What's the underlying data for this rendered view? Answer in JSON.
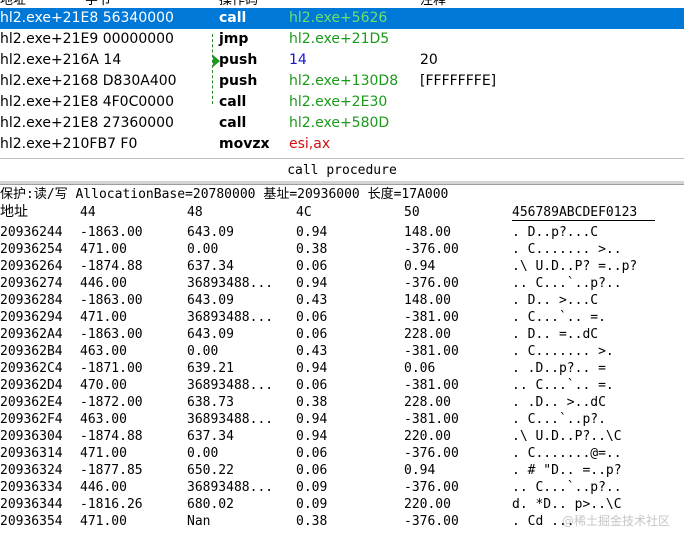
{
  "disasm": {
    "headers": {
      "address": "地址",
      "bytes": "字节",
      "mnemonic": "操作码",
      "comment": "注释"
    },
    "rows": [
      {
        "address": "hl2.exe+21E8 56340000",
        "mnemonic": "call",
        "operand": "hl2.exe+5626",
        "operand_color": "green",
        "comment": "",
        "selected": true
      },
      {
        "address": "hl2.exe+21E9 00000000",
        "mnemonic": "jmp",
        "operand": "hl2.exe+21D5",
        "operand_color": "green",
        "comment": "",
        "selected": false
      },
      {
        "address": "hl2.exe+216A 14",
        "mnemonic": "push",
        "operand": "14",
        "operand_color": "blue",
        "comment": "20",
        "selected": false
      },
      {
        "address": "hl2.exe+2168 D830A400",
        "mnemonic": "push",
        "operand": "hl2.exe+130D8",
        "operand_color": "green",
        "comment": "[FFFFFFFE]",
        "selected": false
      },
      {
        "address": "hl2.exe+21E8 4F0C0000",
        "mnemonic": "call",
        "operand": "hl2.exe+2E30",
        "operand_color": "green",
        "comment": "",
        "selected": false
      },
      {
        "address": "hl2.exe+21E8 27360000",
        "mnemonic": "call",
        "operand": "hl2.exe+580D",
        "operand_color": "green",
        "comment": "",
        "selected": false
      },
      {
        "address": "hl2.exe+210FB7 F0",
        "mnemonic": "movzx",
        "operand": "esi,ax",
        "operand_color": "red",
        "comment": "",
        "selected": false
      }
    ]
  },
  "status_text": "call procedure",
  "memory": {
    "info_line": "保护:读/写  AllocationBase=20780000 基址=20936000 长度=17A000",
    "columns": [
      "地址",
      "44",
      "48",
      "4C",
      "50",
      "456789ABCDEF0123"
    ],
    "rows": [
      [
        "20936244",
        "-1863.00",
        "643.09",
        "0.94",
        "148.00",
        ".       D..p?...C"
      ],
      [
        "20936254",
        "471.00",
        "0.00",
        "0.38",
        "-376.00",
        ".  C.......  >.."
      ],
      [
        "20936264",
        "-1874.88",
        "637.34",
        "0.06",
        "0.94",
        ".\\   U.D..P? =..p?"
      ],
      [
        "20936274",
        "446.00",
        "36893488...",
        "0.94",
        "-376.00",
        ".. C...`..p?.."
      ],
      [
        "20936284",
        "-1863.00",
        "643.09",
        "0.43",
        "148.00",
        ".       D.. >...C"
      ],
      [
        "20936294",
        "471.00",
        "36893488...",
        "0.06",
        "-381.00",
        ".  C...`.. =."
      ],
      [
        "209362A4",
        "-1863.00",
        "643.09",
        "0.06",
        "228.00",
        ".       D.. =..dC"
      ],
      [
        "209362B4",
        "463.00",
        "0.00",
        "0.43",
        "-381.00",
        ".  C.......  >."
      ],
      [
        "209362C4",
        "-1871.00",
        "639.21",
        "0.94",
        "0.06",
        ".       .D..p?.. ="
      ],
      [
        "209362D4",
        "470.00",
        "36893488...",
        "0.06",
        "-381.00",
        ".. C...`.. =."
      ],
      [
        "209362E4",
        "-1872.00",
        "638.73",
        "0.38",
        "228.00",
        ".       .D.. >..dC"
      ],
      [
        "209362F4",
        "463.00",
        "36893488...",
        "0.94",
        "-381.00",
        ".  C...`..p?."
      ],
      [
        "20936304",
        "-1874.88",
        "637.34",
        "0.94",
        "220.00",
        ".\\   U.D..P?..\\C"
      ],
      [
        "20936314",
        "471.00",
        "0.00",
        "0.06",
        "-376.00",
        ".  C.......@=.."
      ],
      [
        "20936324",
        "-1877.85",
        "650.22",
        "0.06",
        "0.94",
        ".    # \"D.. =..p?"
      ],
      [
        "20936334",
        "446.00",
        "36893488...",
        "0.09",
        "-376.00",
        ".. C...`..p?.."
      ],
      [
        "20936344",
        "-1816.26",
        "680.02",
        "0.09",
        "220.00",
        "d.      *D.. p>..\\C"
      ],
      [
        "20936354",
        "471.00",
        "Nan",
        "0.38",
        "-376.00",
        ".  Cd   ..."
      ]
    ]
  },
  "watermark": "@稀土掘金技术社区",
  "colors": {
    "selection": "#0078d7",
    "operand_green": "#1a9a1a",
    "operand_blue": "#1515d6",
    "operand_red": "#d01010"
  }
}
